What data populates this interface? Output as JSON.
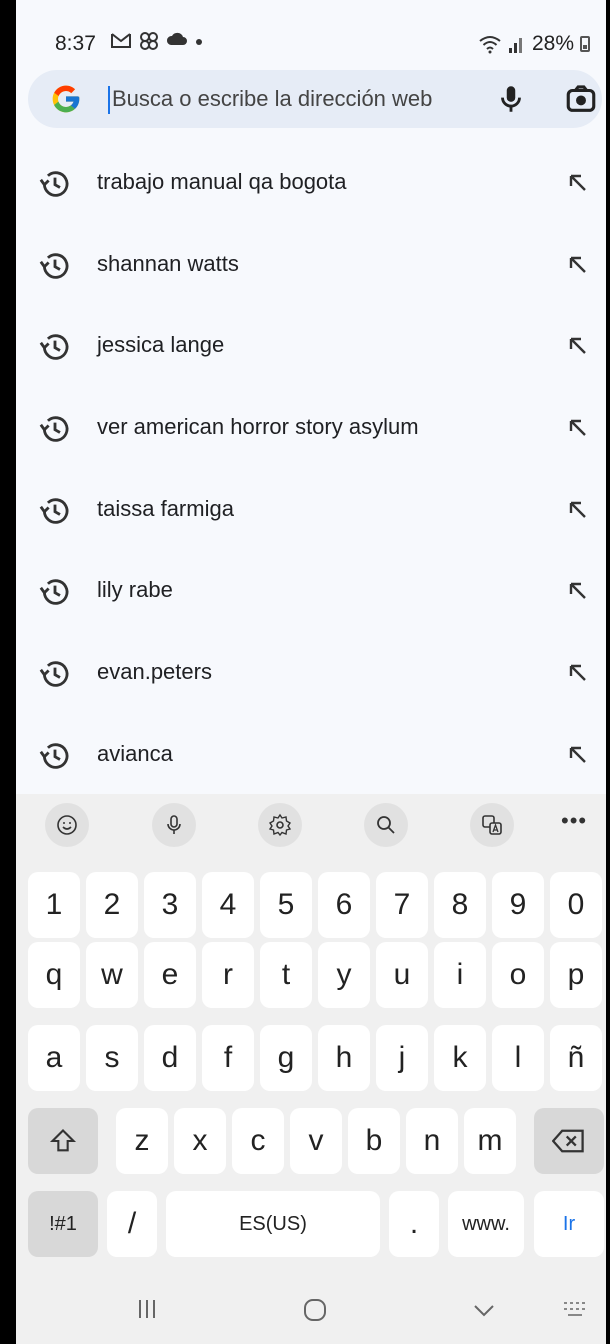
{
  "status_bar": {
    "time": "8:37",
    "left_icons": [
      "gmail-icon",
      "pinwheel-icon",
      "cloud-icon",
      "dot-icon"
    ],
    "signal_text": "28%",
    "right_icons": [
      "wifi-icon",
      "signal-icon",
      "battery-icon"
    ]
  },
  "search": {
    "placeholder": "Busca o escribe la dirección web",
    "value": ""
  },
  "suggestions": [
    {
      "label": "trabajo manual qa bogota"
    },
    {
      "label": "shannan watts"
    },
    {
      "label": "jessica lange"
    },
    {
      "label": "ver american horror story asylum"
    },
    {
      "label": "taissa farmiga"
    },
    {
      "label": "lily rabe"
    },
    {
      "label": "evan.peters"
    },
    {
      "label": "avianca"
    }
  ],
  "keyboard": {
    "toolbar": [
      "emoji-icon",
      "mic-icon",
      "settings-icon",
      "search-icon",
      "translate-icon",
      "more-icon"
    ],
    "more": "•••",
    "row_numbers": [
      "1",
      "2",
      "3",
      "4",
      "5",
      "6",
      "7",
      "8",
      "9",
      "0"
    ],
    "row_1": [
      "q",
      "w",
      "e",
      "r",
      "t",
      "y",
      "u",
      "i",
      "o",
      "p"
    ],
    "row_2": [
      "a",
      "s",
      "d",
      "f",
      "g",
      "h",
      "j",
      "k",
      "l",
      "ñ"
    ],
    "row_3": [
      "z",
      "x",
      "c",
      "v",
      "b",
      "n",
      "m"
    ],
    "row_4": {
      "symbols": "!#1",
      "slash": "/",
      "space": "ES(US)",
      "period": ".",
      "www": "www.",
      "go": "Ir"
    }
  },
  "colors": {
    "accent": "#1a73e8",
    "background": "#f7f9fd",
    "search_bg": "#e6ecf6"
  }
}
